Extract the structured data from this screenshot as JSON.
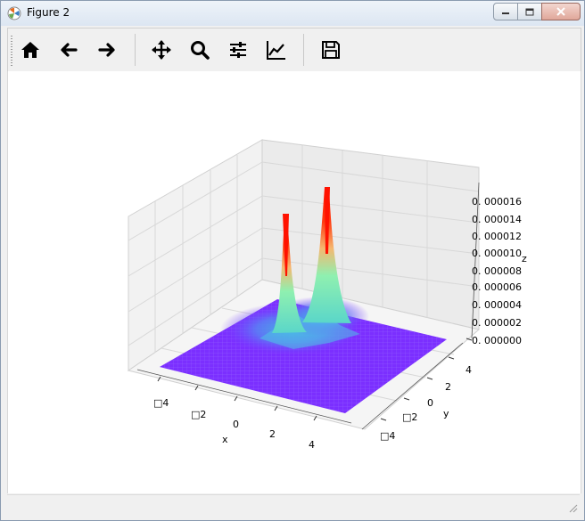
{
  "window": {
    "title": "Figure 2",
    "icon": "matplotlib-icon"
  },
  "toolbar": {
    "buttons": [
      {
        "id": "home",
        "icon": "home-icon"
      },
      {
        "id": "back",
        "icon": "arrow-left-icon"
      },
      {
        "id": "forward",
        "icon": "arrow-right-icon"
      },
      {
        "id": "pan",
        "icon": "move-icon"
      },
      {
        "id": "zoom",
        "icon": "magnifier-icon"
      },
      {
        "id": "subplots",
        "icon": "sliders-icon"
      },
      {
        "id": "edit",
        "icon": "line-chart-icon"
      },
      {
        "id": "save",
        "icon": "floppy-icon"
      }
    ]
  },
  "plot": {
    "x_label": "x",
    "y_label": "y",
    "z_label": "z",
    "x_ticks": [
      "□4",
      "□2",
      "0",
      "2",
      "4"
    ],
    "y_ticks": [
      "□4",
      "□2",
      "0",
      "2",
      "4"
    ],
    "z_ticks": [
      "0. 000000",
      "0. 000002",
      "0. 000004",
      "0. 000006",
      "0. 000008",
      "0. 000010",
      "0. 000012",
      "0. 000014",
      "0. 000016"
    ]
  },
  "colors": {
    "surface_low": "#7b2fff",
    "peak_high": "#ff1a00",
    "mid": "#4be3c8"
  }
}
